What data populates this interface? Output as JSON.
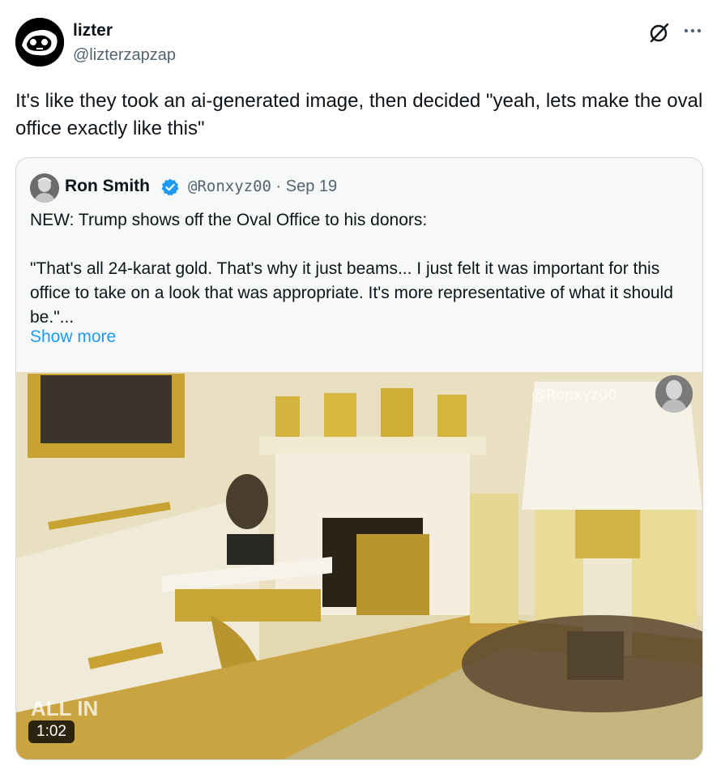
{
  "post": {
    "author_name": "lizter",
    "author_handle": "@lizterzapzap",
    "text": "It's like they took an ai-generated image, then decided \"yeah, lets make the oval office exactly like this\""
  },
  "quoted": {
    "author_name": "Ron Smith",
    "author_handle": "@Ronxyz00",
    "separator": " · ",
    "date": "Sep 19",
    "text": "NEW: Trump shows off the Oval Office to his donors:\n\n\"That's all 24-karat gold. That's why it just beams... I just felt it was important for this office to take on a look that was appropriate. It's more representative of what it should be.\"...",
    "show_more": "Show more",
    "video": {
      "watermark": "@Ronxyz00",
      "duration": "1:02",
      "corner_logo": "ALL IN"
    }
  },
  "icons": {
    "grok": "grok-icon",
    "more": "more-icon",
    "verified": "verified-badge-icon"
  },
  "colors": {
    "link": "#1d9bf0",
    "secondary_text": "#536471",
    "verified": "#1d9bf0"
  }
}
